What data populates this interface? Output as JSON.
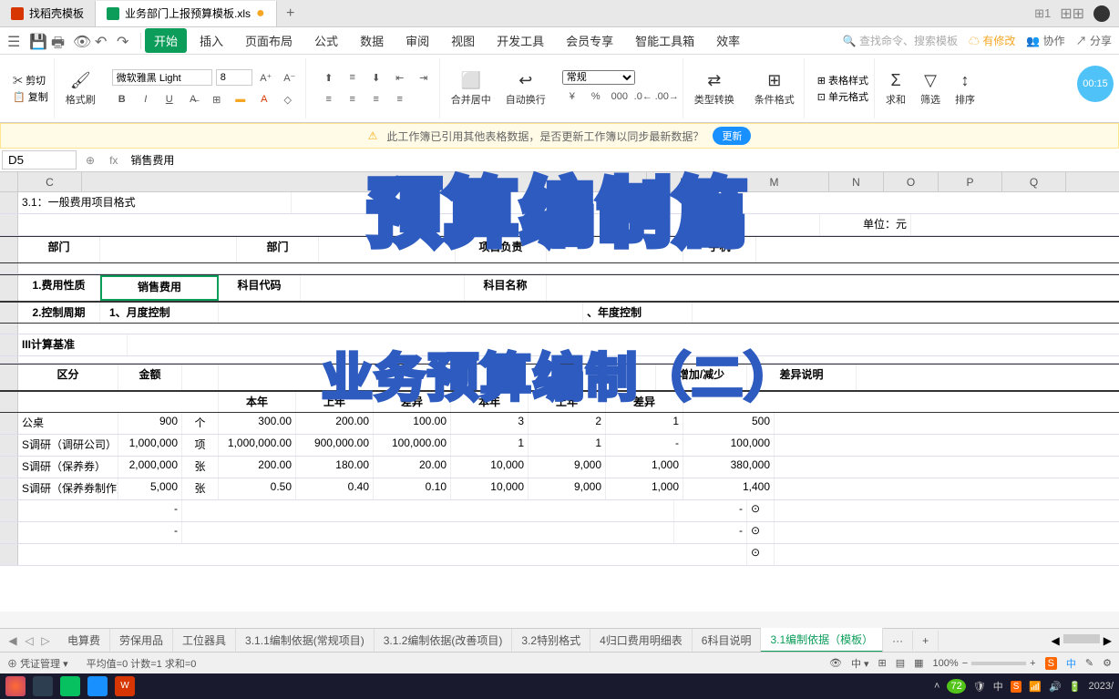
{
  "tabs": {
    "tab1": "找稻壳模板",
    "tab2": "业务部门上报预算模板.xls",
    "plus": "+"
  },
  "menu": {
    "start": "开始",
    "insert": "插入",
    "layout": "页面布局",
    "formula": "公式",
    "data": "数据",
    "review": "审阅",
    "view": "视图",
    "dev": "开发工具",
    "member": "会员专享",
    "smart": "智能工具箱",
    "efficiency": "效率",
    "search_ph": "查找命令、搜索模板",
    "modified": "有修改",
    "collab": "协作",
    "share": "分享"
  },
  "ribbon": {
    "cut": "剪切",
    "copy": "复制",
    "brush": "格式刷",
    "font_name": "微软雅黑 Light",
    "font_size": "8",
    "merge": "合并居中",
    "wrap": "自动换行",
    "general": "常规",
    "type_convert": "类型转换",
    "cond_format": "条件格式",
    "table_style": "表格样式",
    "cell_style": "单元格式",
    "sum": "求和",
    "filter": "筛选",
    "sort": "排序",
    "timer": "00:15"
  },
  "notice": {
    "text": "此工作簿已引用其他表格数据，是否更新工作簿以同步最新数据？",
    "update": "更新"
  },
  "formula": {
    "cell": "D5",
    "fx": "fx",
    "value": "销售费用"
  },
  "cols": [
    "C",
    "",
    "",
    "",
    "",
    "",
    "",
    "",
    "",
    "L",
    "M",
    "N",
    "O",
    "P",
    "Q"
  ],
  "sheet": {
    "title_row": "3.1：一般费用项目格式",
    "unit": "单位：元",
    "dept_label": "部门",
    "dept2": "部门",
    "proj_resp": "项目负责",
    "phone": "手机",
    "expense_nature": "1.费用性质",
    "sales_exp": "销售费用",
    "subject_code": "科目代码",
    "subject_name": "科目名称",
    "control_period": "2.控制周期",
    "monthly": "1、月度控制",
    "yearly": "、年度控制",
    "calc_base": "III计算基准",
    "section": "区分",
    "amount": "金额",
    "this_year": "本年",
    "last_year": "上年",
    "diff": "差异",
    "increase": "增加/减少",
    "diff_desc": "差异说明",
    "rows": [
      {
        "name": "公桌",
        "amt": "900",
        "unit": "个",
        "ty": "300.00",
        "ly": "200.00",
        "d": "100.00",
        "ty2": "3",
        "ly2": "2",
        "d2": "1",
        "inc": "500"
      },
      {
        "name": "S调研（调研公司）",
        "amt": "1,000,000",
        "unit": "项",
        "ty": "1,000,000.00",
        "ly": "900,000.00",
        "d": "100,000.00",
        "ty2": "1",
        "ly2": "1",
        "d2": "-",
        "inc": "100,000"
      },
      {
        "name": "S调研（保养券）",
        "amt": "2,000,000",
        "unit": "张",
        "ty": "200.00",
        "ly": "180.00",
        "d": "20.00",
        "ty2": "10,000",
        "ly2": "9,000",
        "d2": "1,000",
        "inc": "380,000"
      },
      {
        "name": "S调研（保养券制作）",
        "amt": "5,000",
        "unit": "张",
        "ty": "0.50",
        "ly": "0.40",
        "d": "0.10",
        "ty2": "10,000",
        "ly2": "9,000",
        "d2": "1,000",
        "inc": "1,400"
      }
    ]
  },
  "overlay": {
    "title1": "预算编制篇",
    "title2": "业务预算编制（二）"
  },
  "sheet_tabs": {
    "t1": "电算费",
    "t2": "劳保用品",
    "t3": "工位器具",
    "t4": "3.1.1编制依据(常规项目)",
    "t5": "3.1.2编制依据(改善项目)",
    "t6": "3.2特别格式",
    "t7": "4归口费用明细表",
    "t8": "6科目说明",
    "t9": "3.1编制依据（模板）",
    "more": "···"
  },
  "status": {
    "cred": "凭证管理",
    "avg": "平均值=0  计数=1  求和=0",
    "zoom": "100%"
  },
  "taskbar": {
    "time": "2023/",
    "badge": "72",
    "ime": "中"
  }
}
